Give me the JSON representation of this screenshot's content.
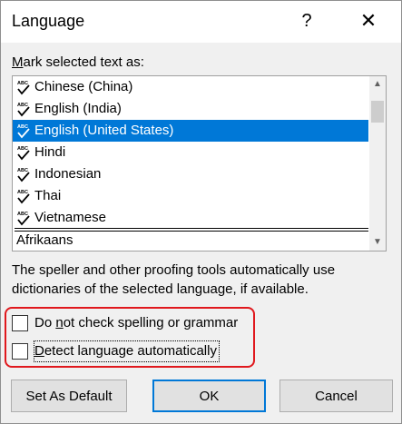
{
  "dialog": {
    "title": "Language",
    "help_label": "?",
    "close_label": "✕"
  },
  "mark_label": {
    "underlined": "M",
    "rest": "ark selected text as:"
  },
  "languages": [
    {
      "label": "Chinese (China)",
      "selected": false
    },
    {
      "label": "English (India)",
      "selected": false
    },
    {
      "label": "English (United States)",
      "selected": true
    },
    {
      "label": "Hindi",
      "selected": false
    },
    {
      "label": "Indonesian",
      "selected": false
    },
    {
      "label": "Thai",
      "selected": false
    },
    {
      "label": "Vietnamese",
      "selected": false
    }
  ],
  "list_bottom_item": "Afrikaans",
  "scrollbar": {
    "up": "▲",
    "down": "▼"
  },
  "description": "The speller and other proofing tools automatically use dictionaries of the selected language, if available.",
  "options": {
    "no_check": {
      "pre": "Do ",
      "underlined": "n",
      "post": "ot check spelling or grammar",
      "checked": false
    },
    "detect": {
      "pre": "",
      "underlined": "D",
      "post": "etect language automatically",
      "checked": false
    }
  },
  "buttons": {
    "set_default": "Set As Default",
    "ok": "OK",
    "cancel": "Cancel"
  },
  "colors": {
    "selection": "#0078d7",
    "highlight_box": "#e0181d",
    "default_button_border": "#0078d7"
  }
}
